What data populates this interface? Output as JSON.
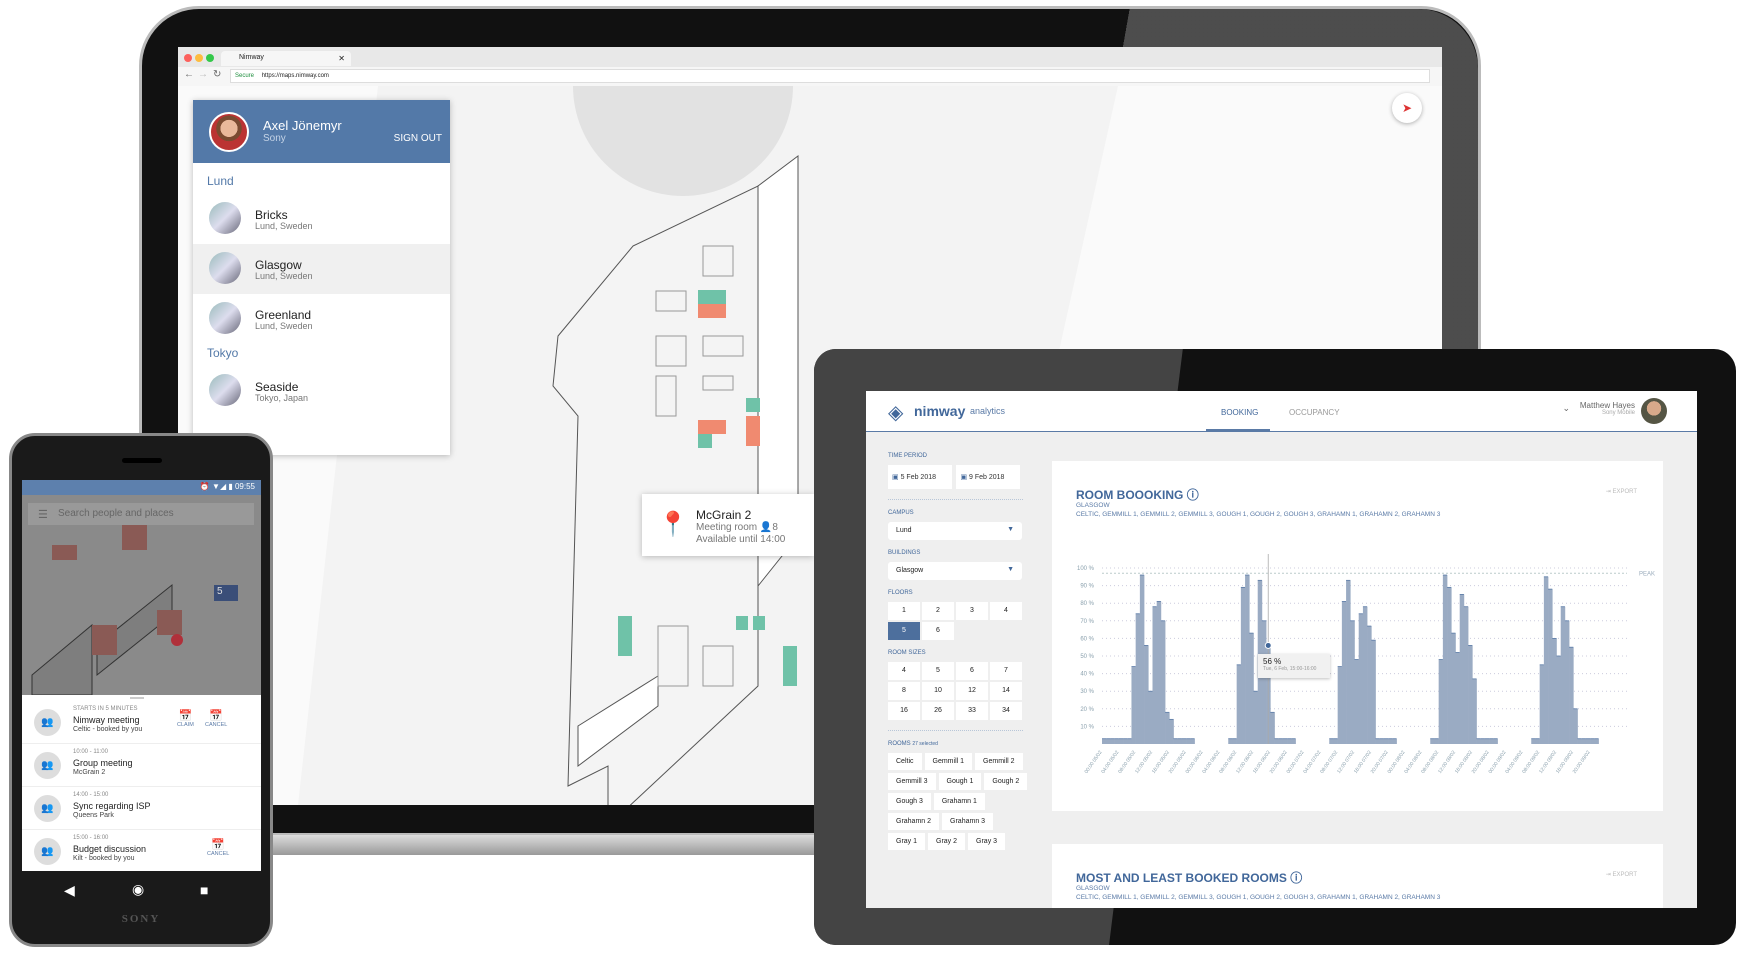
{
  "laptop": {
    "browser": {
      "tab_title": "Nimway",
      "secure_label": "Secure",
      "url": "https://maps.nimway.com"
    },
    "user": {
      "name": "Axel Jönemyr",
      "org": "Sony",
      "sign_out": "SIGN OUT"
    },
    "groups": [
      {
        "label": "Lund",
        "places": [
          {
            "name": "Bricks",
            "address": "Lund, Sweden"
          },
          {
            "name": "Glasgow",
            "address": "Lund, Sweden",
            "selected": true
          },
          {
            "name": "Greenland",
            "address": "Lund, Sweden"
          }
        ]
      },
      {
        "label": "Tokyo",
        "places": [
          {
            "name": "Seaside",
            "address": "Tokyo, Japan"
          }
        ]
      }
    ],
    "room_popup": {
      "title": "McGrain 2",
      "type": "Meeting room",
      "capacity": "8",
      "availability": "Available until 14:00"
    },
    "colors": {
      "booked": "#f08a70",
      "free": "#6fc2a8",
      "brand": "#5379a8"
    }
  },
  "tablet": {
    "brand": "nimway",
    "brand_sub": "analytics",
    "tabs": [
      "BOOKING",
      "OCCUPANCY"
    ],
    "active_tab": "BOOKING",
    "user": {
      "name": "Matthew Hayes",
      "org": "Sony Mobile"
    },
    "filters": {
      "time_period_label": "TIME PERIOD",
      "start": "5 Feb 2018",
      "end": "9 Feb 2018",
      "campus_label": "CAMPUS",
      "campus": "Lund",
      "buildings_label": "BUILDINGS",
      "building": "Glasgow",
      "floors_label": "FLOORS",
      "floors": [
        "1",
        "2",
        "3",
        "4",
        "5",
        "6"
      ],
      "selected_floor": "5",
      "room_sizes_label": "ROOM SIZES",
      "room_sizes": [
        "4",
        "5",
        "6",
        "7",
        "8",
        "10",
        "12",
        "14",
        "16",
        "26",
        "33",
        "34"
      ],
      "rooms_label": "ROOMS",
      "rooms_selected": "27 selected",
      "rooms": [
        "Celtic",
        "Gemmill 1",
        "Gemmill 2",
        "Gemmill 3",
        "Gough 1",
        "Gough 2",
        "Gough 3",
        "Grahamn 1",
        "Grahamn 2",
        "Grahamn 3",
        "Gray 1",
        "Gray 2",
        "Gray 3"
      ]
    },
    "card1": {
      "title": "ROOM BOOOKING",
      "building": "GLASGOW",
      "rooms": "CELTIC, GEMMILL 1, GEMMILL 2, GEMMILL 3, GOUGH 1, GOUGH 2, GOUGH 3, GRAHAMN 1, GRAHAMN 2, GRAHAMN 3",
      "export": "EXPORT"
    },
    "card2": {
      "title": "MOST AND LEAST BOOKED ROOMS",
      "building": "GLASGOW",
      "rooms": "CELTIC, GEMMILL 1, GEMMILL 2, GEMMILL 3, GOUGH 1, GOUGH 2, GOUGH 3, GRAHAMN 1, GRAHAMN 2, GRAHAMN 3",
      "export": "EXPORT"
    },
    "tooltip": {
      "value": "56 %",
      "label": "Tue, 6 Feb, 15:00-16:00"
    }
  },
  "chart_data": {
    "type": "area",
    "title": "ROOM BOOOKING",
    "ylim": [
      0,
      100
    ],
    "y_ticks": [
      "10 %",
      "20 %",
      "30 %",
      "40 %",
      "50 %",
      "60 %",
      "70 %",
      "80 %",
      "90 %",
      "100 %"
    ],
    "peak_label": "PEAK",
    "peak_value": 97,
    "x_ticks": [
      "00:00 05/02",
      "04:00 05/02",
      "08:00 05/02",
      "12:00 05/02",
      "16:00 05/02",
      "20:00 05/02",
      "00:00 06/02",
      "04:00 06/02",
      "08:00 06/02",
      "12:00 06/02",
      "16:00 06/02",
      "20:00 06/02",
      "00:00 07/02",
      "04:00 07/02",
      "08:00 07/02",
      "12:00 07/02",
      "16:00 07/02",
      "20:00 07/02",
      "00:00 08/02",
      "04:00 08/02",
      "08:00 08/02",
      "12:00 08/02",
      "16:00 08/02",
      "20:00 08/02",
      "00:00 09/02",
      "04:00 09/02",
      "08:00 09/02",
      "12:00 09/02",
      "16:00 09/02",
      "20:00 09/02"
    ],
    "hourly_by_day": [
      {
        "date": "05/02",
        "values": [
          3,
          3,
          3,
          3,
          3,
          3,
          3,
          44,
          74,
          96,
          56,
          30,
          78,
          81,
          70,
          18,
          14,
          3,
          3,
          3,
          3,
          3,
          0,
          0
        ]
      },
      {
        "date": "06/02",
        "values": [
          0,
          0,
          0,
          0,
          0,
          0,
          3,
          3,
          45,
          89,
          96,
          63,
          30,
          93,
          70,
          56,
          18,
          3,
          3,
          3,
          3,
          3,
          0,
          0
        ]
      },
      {
        "date": "07/02",
        "values": [
          0,
          0,
          0,
          0,
          0,
          0,
          3,
          3,
          44,
          81,
          93,
          70,
          48,
          74,
          78,
          67,
          59,
          3,
          3,
          3,
          3,
          3,
          0,
          0
        ]
      },
      {
        "date": "08/02",
        "values": [
          0,
          0,
          0,
          0,
          0,
          0,
          3,
          3,
          48,
          96,
          89,
          63,
          52,
          85,
          78,
          56,
          37,
          3,
          3,
          3,
          3,
          3,
          0,
          0
        ]
      },
      {
        "date": "09/02",
        "values": [
          0,
          0,
          0,
          0,
          0,
          0,
          3,
          3,
          45,
          95,
          88,
          60,
          50,
          78,
          70,
          55,
          20,
          3,
          3,
          3,
          3,
          3,
          0,
          0
        ]
      }
    ],
    "highlight": {
      "x": "15:00 06/02",
      "y": 56
    },
    "color": "#9aabc3"
  },
  "phone": {
    "time": "09:55",
    "search_placeholder": "Search people and places",
    "floor_badge": "5",
    "events": [
      {
        "time": "STARTS IN 5 MINUTES",
        "title": "Nimway meeting",
        "sub": "Celtic - booked by you",
        "actions": [
          "CLAIM",
          "CANCEL"
        ]
      },
      {
        "time": "10:00 - 11:00",
        "title": "Group meeting",
        "sub": "McGrain 2",
        "actions": []
      },
      {
        "time": "14:00 - 15:00",
        "title": "Sync regarding ISP",
        "sub": "Queens Park",
        "actions": []
      },
      {
        "time": "15:00 - 16:00",
        "title": "Budget discussion",
        "sub": "Kilt - booked by you",
        "actions": [
          "CANCEL"
        ]
      }
    ],
    "brand": "SONY"
  }
}
